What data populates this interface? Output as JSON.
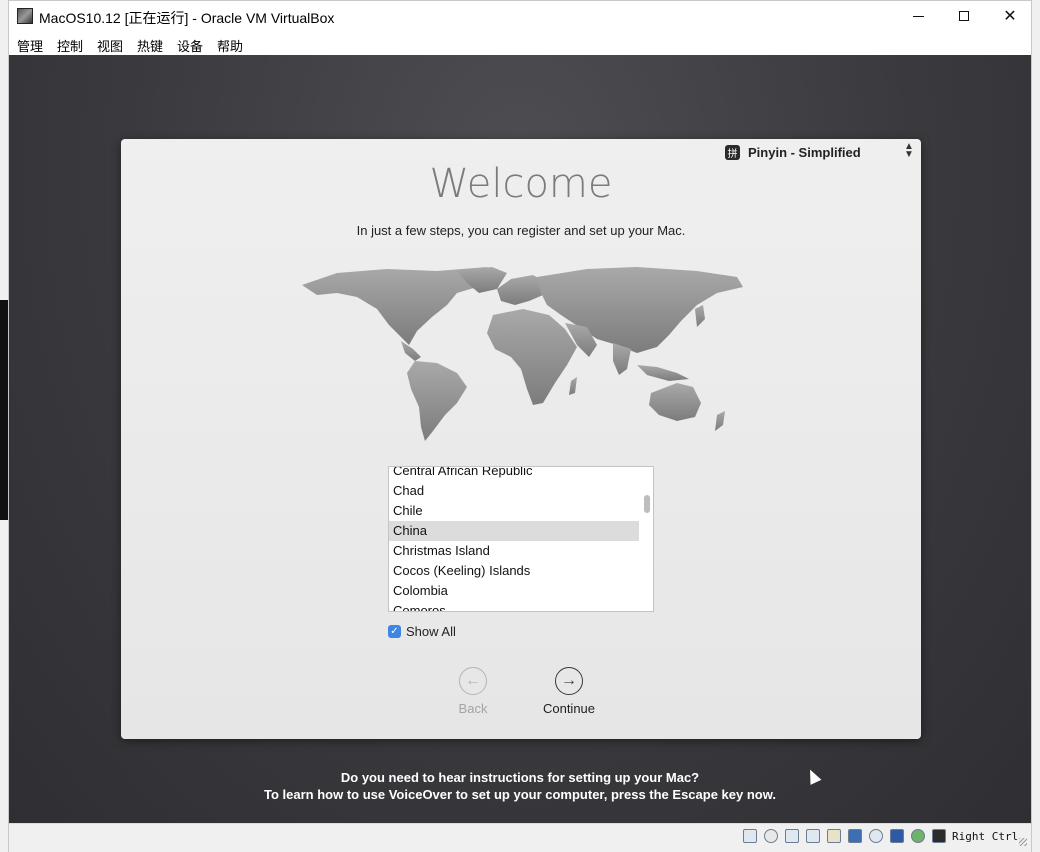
{
  "window": {
    "title": "MacOS10.12 [正在运行] - Oracle VM VirtualBox",
    "icon": "virtualbox-app-icon",
    "controls": [
      "minimize-icon",
      "maximize-icon",
      "close-icon"
    ]
  },
  "menu": {
    "items": [
      {
        "label": "管理"
      },
      {
        "label": "控制"
      },
      {
        "label": "视图"
      },
      {
        "label": "热键"
      },
      {
        "label": "设备"
      },
      {
        "label": "帮助"
      }
    ]
  },
  "setup": {
    "input_method": {
      "icon_glyph": "拼",
      "label": "Pinyin - Simplified"
    },
    "title": "Welcome",
    "subtitle": "In just a few steps, you can register and set up your Mac.",
    "countries": [
      {
        "label": "Central African Republic",
        "selected": false
      },
      {
        "label": "Chad",
        "selected": false
      },
      {
        "label": "Chile",
        "selected": false
      },
      {
        "label": "China",
        "selected": true
      },
      {
        "label": "Christmas Island",
        "selected": false
      },
      {
        "label": "Cocos (Keeling) Islands",
        "selected": false
      },
      {
        "label": "Colombia",
        "selected": false
      },
      {
        "label": "Comoros",
        "selected": false
      }
    ],
    "show_all": {
      "label": "Show All",
      "checked": true
    },
    "back_label": "Back",
    "continue_label": "Continue",
    "voiceover_line1": "Do you need to hear instructions for setting up your Mac?",
    "voiceover_line2": "To learn how to use VoiceOver to set up your computer, press the Escape key now."
  },
  "statusbar": {
    "icons": [
      "hard-disk-icon",
      "optical-drive-icon",
      "network-icon",
      "usb-icon",
      "shared-folder-icon",
      "display-icon",
      "video-capture-icon",
      "cpu-icon",
      "mouse-integration-icon",
      "download-icon"
    ],
    "host_key": "Right Ctrl"
  },
  "colors": {
    "vm_background": "#3a3a3e",
    "panel": "#ececec",
    "selection": "#dcdcdc",
    "checkbox_accent": "#3b87e3"
  }
}
